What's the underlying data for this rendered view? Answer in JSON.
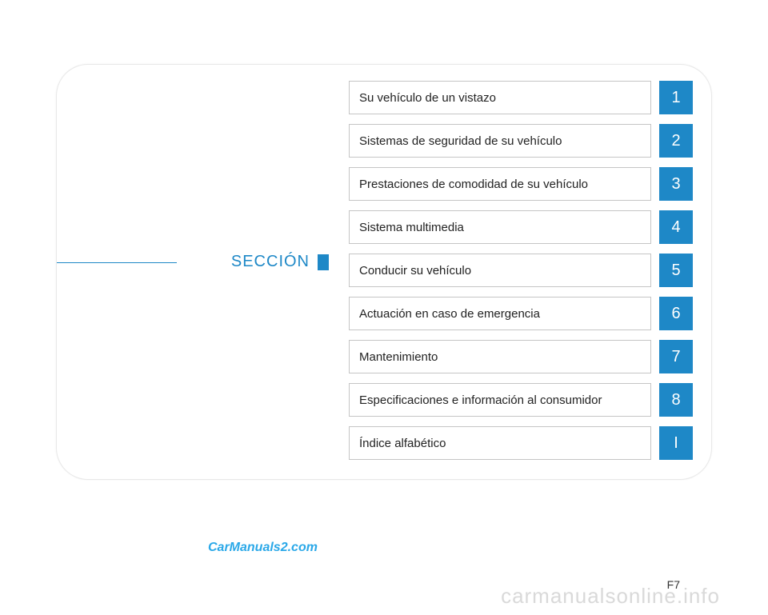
{
  "section_label": "SECCIÓN",
  "toc": [
    {
      "label": "Su vehículo de un vistazo",
      "num": "1"
    },
    {
      "label": "Sistemas de seguridad de su vehículo",
      "num": "2"
    },
    {
      "label": "Prestaciones de comodidad de su vehículo",
      "num": "3"
    },
    {
      "label": "Sistema multimedia",
      "num": "4"
    },
    {
      "label": "Conducir su vehículo",
      "num": "5"
    },
    {
      "label": "Actuación en caso de emergencia",
      "num": "6"
    },
    {
      "label": "Mantenimiento",
      "num": "7"
    },
    {
      "label": "Especificaciones e información al consumidor",
      "num": "8"
    },
    {
      "label": "Índice alfabético",
      "num": "I"
    }
  ],
  "page_number": "F7",
  "watermark1": "CarManuals2.com",
  "watermark2": "carmanualsonline.info"
}
